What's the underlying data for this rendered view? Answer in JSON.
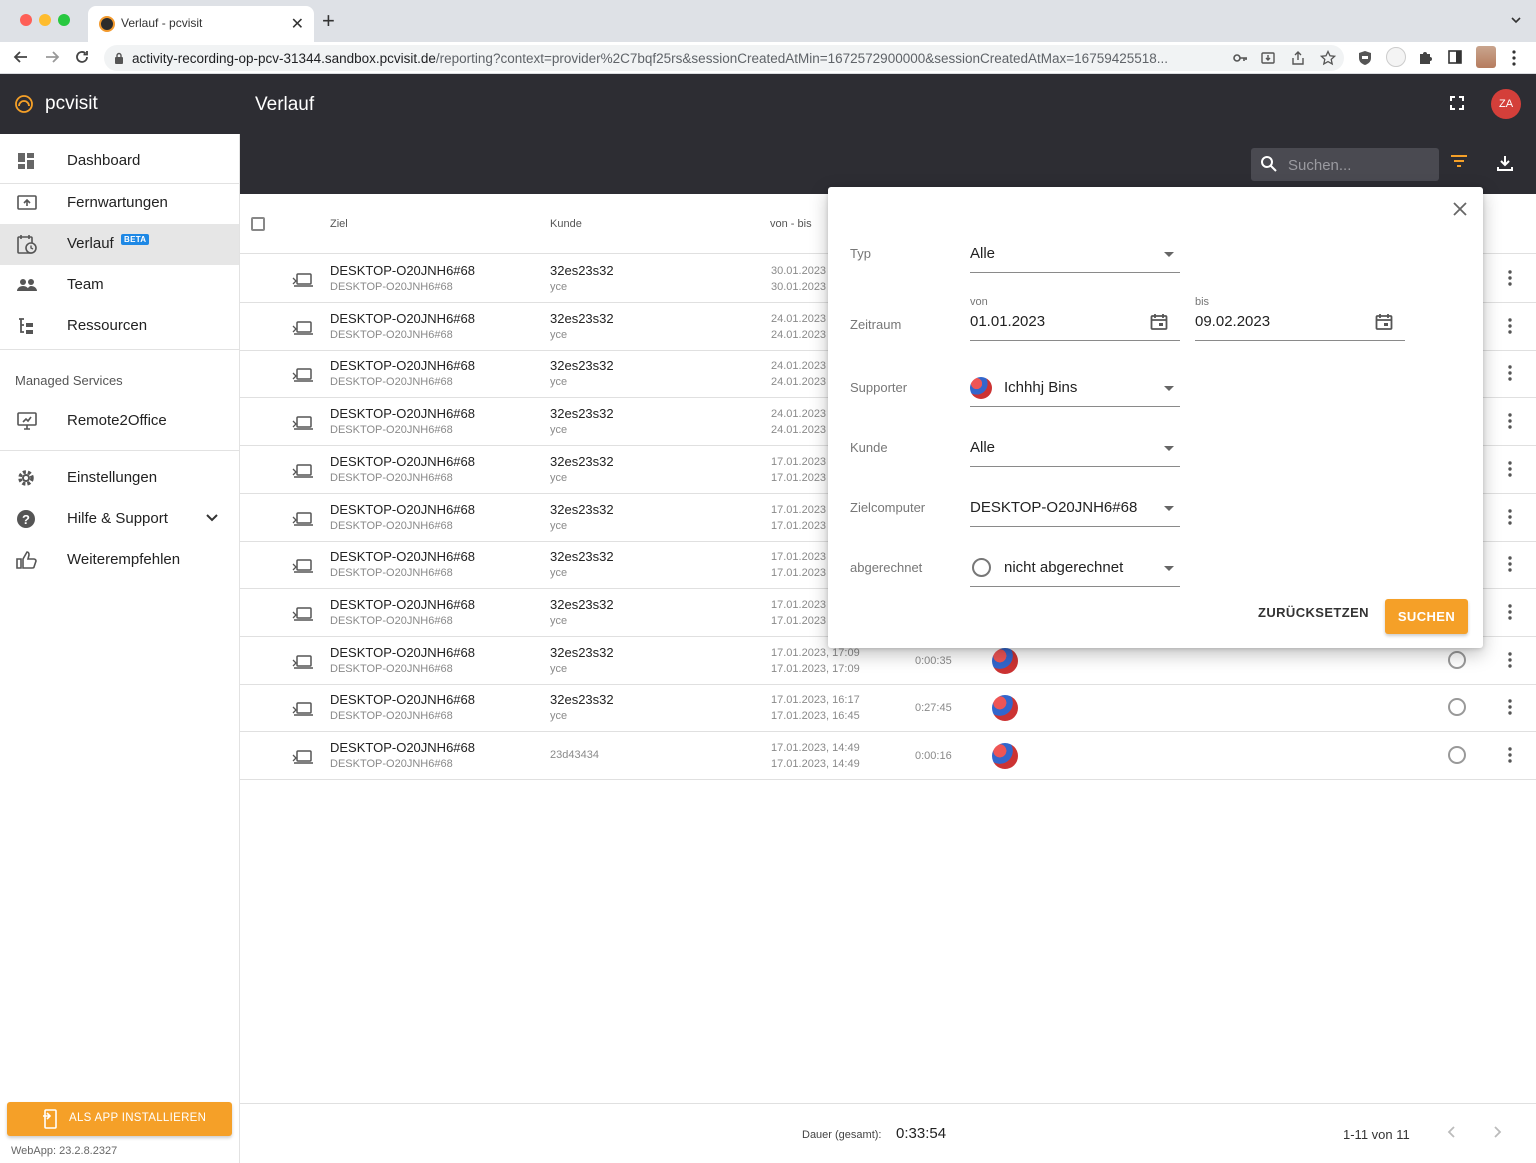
{
  "browser": {
    "tab_title": "Verlauf - pcvisit",
    "url_host": "activity-recording-op-pcv-31344.sandbox.pcvisit.de",
    "url_rest": "/reporting?context=provider%2C7bqf25rs&sessionCreatedAtMin=1672572900000&sessionCreatedAtMax=16759425518..."
  },
  "brand": {
    "name": "pcvisit"
  },
  "sidebar": {
    "items": [
      {
        "label": "Dashboard",
        "icon": "dashboard-icon"
      },
      {
        "label": "Fernwartungen",
        "icon": "remote-icon"
      },
      {
        "label": "Verlauf",
        "icon": "history-icon",
        "badge": "BETA",
        "active": true
      },
      {
        "label": "Team",
        "icon": "team-icon"
      },
      {
        "label": "Ressourcen",
        "icon": "resources-icon"
      }
    ],
    "section_title": "Managed Services",
    "managed": [
      {
        "label": "Remote2Office",
        "icon": "monitor-icon"
      }
    ],
    "bottom": [
      {
        "label": "Einstellungen",
        "icon": "gear-icon"
      },
      {
        "label": "Hilfe & Support",
        "icon": "help-icon"
      },
      {
        "label": "Weiterempfehlen",
        "icon": "thumbs-up-icon"
      }
    ],
    "install_label": "ALS APP INSTALLIEREN",
    "version": "WebApp: 23.2.8.2327"
  },
  "header": {
    "title": "Verlauf",
    "avatar_initials": "ZA",
    "search_placeholder": "Suchen..."
  },
  "table": {
    "columns": {
      "ziel": "Ziel",
      "kunde": "Kunde",
      "zeit": "von - bis"
    },
    "rows": [
      {
        "ziel": "DESKTOP-O20JNH6#68",
        "ziel_sub": "DESKTOP-O20JNH6#68",
        "kunde": "32es23s32",
        "kunde_sub": "yce",
        "von": "30.01.2023",
        "bis": "30.01.2023",
        "dauer": ""
      },
      {
        "ziel": "DESKTOP-O20JNH6#68",
        "ziel_sub": "DESKTOP-O20JNH6#68",
        "kunde": "32es23s32",
        "kunde_sub": "yce",
        "von": "24.01.2023",
        "bis": "24.01.2023",
        "dauer": ""
      },
      {
        "ziel": "DESKTOP-O20JNH6#68",
        "ziel_sub": "DESKTOP-O20JNH6#68",
        "kunde": "32es23s32",
        "kunde_sub": "yce",
        "von": "24.01.2023",
        "bis": "24.01.2023",
        "dauer": ""
      },
      {
        "ziel": "DESKTOP-O20JNH6#68",
        "ziel_sub": "DESKTOP-O20JNH6#68",
        "kunde": "32es23s32",
        "kunde_sub": "yce",
        "von": "24.01.2023",
        "bis": "24.01.2023",
        "dauer": ""
      },
      {
        "ziel": "DESKTOP-O20JNH6#68",
        "ziel_sub": "DESKTOP-O20JNH6#68",
        "kunde": "32es23s32",
        "kunde_sub": "yce",
        "von": "17.01.2023",
        "bis": "17.01.2023",
        "dauer": ""
      },
      {
        "ziel": "DESKTOP-O20JNH6#68",
        "ziel_sub": "DESKTOP-O20JNH6#68",
        "kunde": "32es23s32",
        "kunde_sub": "yce",
        "von": "17.01.2023",
        "bis": "17.01.2023",
        "dauer": ""
      },
      {
        "ziel": "DESKTOP-O20JNH6#68",
        "ziel_sub": "DESKTOP-O20JNH6#68",
        "kunde": "32es23s32",
        "kunde_sub": "yce",
        "von": "17.01.2023",
        "bis": "17.01.2023",
        "dauer": ""
      },
      {
        "ziel": "DESKTOP-O20JNH6#68",
        "ziel_sub": "DESKTOP-O20JNH6#68",
        "kunde": "32es23s32",
        "kunde_sub": "yce",
        "von": "17.01.2023",
        "bis": "17.01.2023",
        "dauer": ""
      },
      {
        "ziel": "DESKTOP-O20JNH6#68",
        "ziel_sub": "DESKTOP-O20JNH6#68",
        "kunde": "32es23s32",
        "kunde_sub": "yce",
        "von": "17.01.2023, 17:09",
        "bis": "17.01.2023, 17:09",
        "dauer": "0:00:35"
      },
      {
        "ziel": "DESKTOP-O20JNH6#68",
        "ziel_sub": "DESKTOP-O20JNH6#68",
        "kunde": "32es23s32",
        "kunde_sub": "yce",
        "von": "17.01.2023, 16:17",
        "bis": "17.01.2023, 16:45",
        "dauer": "0:27:45"
      },
      {
        "ziel": "DESKTOP-O20JNH6#68",
        "ziel_sub": "DESKTOP-O20JNH6#68",
        "kunde": "23d43434",
        "kunde_sub": "",
        "von": "17.01.2023, 14:49",
        "bis": "17.01.2023, 14:49",
        "dauer": "0:00:16"
      }
    ]
  },
  "footer": {
    "duration_label": "Dauer (gesamt):",
    "duration_value": "0:33:54",
    "pagination": "1-11 von 11"
  },
  "filter": {
    "typ_label": "Typ",
    "typ_value": "Alle",
    "zeitraum_label": "Zeitraum",
    "von_label": "von",
    "von_value": "01.01.2023",
    "bis_label": "bis",
    "bis_value": "09.02.2023",
    "supporter_label": "Supporter",
    "supporter_value": "Ichhhj Bins",
    "kunde_label": "Kunde",
    "kunde_value": "Alle",
    "zielcomputer_label": "Zielcomputer",
    "zielcomputer_value": "DESKTOP-O20JNH6#68",
    "abgerechnet_label": "abgerechnet",
    "abgerechnet_value": "nicht abgerechnet",
    "reset_label": "ZURÜCKSETZEN",
    "search_label": "SUCHEN"
  },
  "colors": {
    "accent": "#f5a028",
    "header_bg": "#2d2d33",
    "beta": "#1e88e5",
    "avatar": "#d43f3a"
  }
}
